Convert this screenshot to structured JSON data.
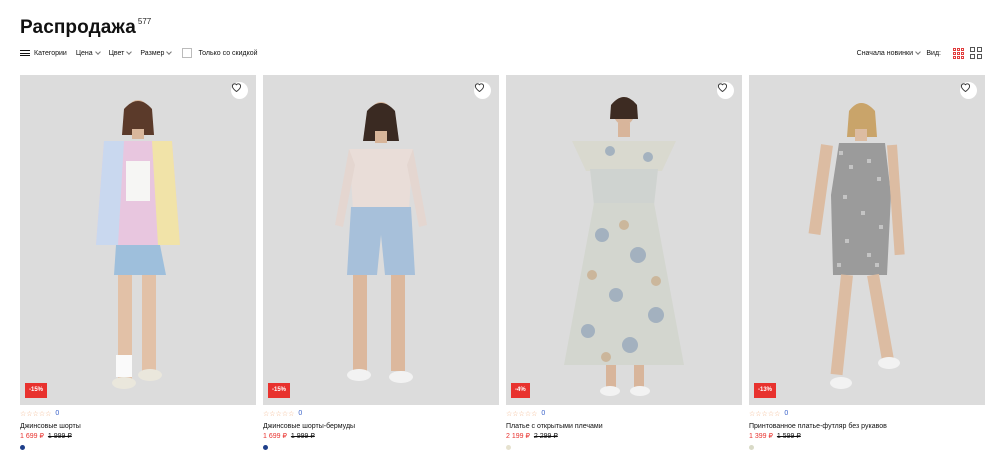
{
  "page": {
    "title": "Распродажа",
    "count": "577"
  },
  "filters": {
    "categories": "Категории",
    "price": "Цена",
    "color": "Цвет",
    "size": "Размер",
    "discount_only": "Только со скидкой"
  },
  "sort": {
    "label": "Сначала новинки"
  },
  "view": {
    "label": "Вид:"
  },
  "colors": {
    "accent": "#e8322e",
    "rating_link": "#3a62c9",
    "stars": "#f2b48a"
  },
  "products": [
    {
      "name": "Джинсовые шорты",
      "price": "1 699 ₽",
      "old_price": "1 999 ₽",
      "discount": "-15%",
      "rating_count": "0",
      "stars": "☆☆☆☆☆",
      "swatch": "#1f3f8a"
    },
    {
      "name": "Джинсовые шорты-бермуды",
      "price": "1 699 ₽",
      "old_price": "1 999 ₽",
      "discount": "-15%",
      "rating_count": "0",
      "stars": "☆☆☆☆☆",
      "swatch": "#1f3f8a"
    },
    {
      "name": "Платье с открытыми плечами",
      "price": "2 199 ₽",
      "old_price": "2 299 ₽",
      "discount": "-4%",
      "rating_count": "0",
      "stars": "☆☆☆☆☆",
      "swatch": "#e6e2cf"
    },
    {
      "name": "Принтованное платье-футляр без рукавов",
      "price": "1 399 ₽",
      "old_price": "1 599 ₽",
      "discount": "-13%",
      "rating_count": "0",
      "stars": "☆☆☆☆☆",
      "swatch": "#d9dac7"
    }
  ]
}
